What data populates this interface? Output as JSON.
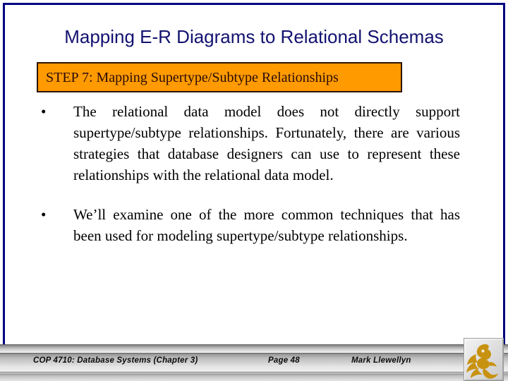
{
  "slide": {
    "title": "Mapping E-R Diagrams to Relational Schemas",
    "accent_orange": "#FF9A00",
    "title_color": "#121270",
    "border_color": "#000080"
  },
  "step_banner": {
    "text": "STEP 7:  Mapping Supertype/Subtype Relationships"
  },
  "bullets": [
    {
      "marker": "•",
      "text": "The relational data model does not directly support supertype/subtype relationships. Fortunately, there are various strategies that database designers can use to represent these relationships with the relational data model."
    },
    {
      "marker": "•",
      "text": "We’ll examine one of the more common techniques that has been used for modeling supertype/subtype relationships."
    }
  ],
  "footer": {
    "course": "COP 4710: Database Systems  (Chapter 3)",
    "page": "Page 48",
    "author": "Mark Llewellyn",
    "logo": "ucf-pegasus-logo",
    "logo_color": "#C89211"
  }
}
